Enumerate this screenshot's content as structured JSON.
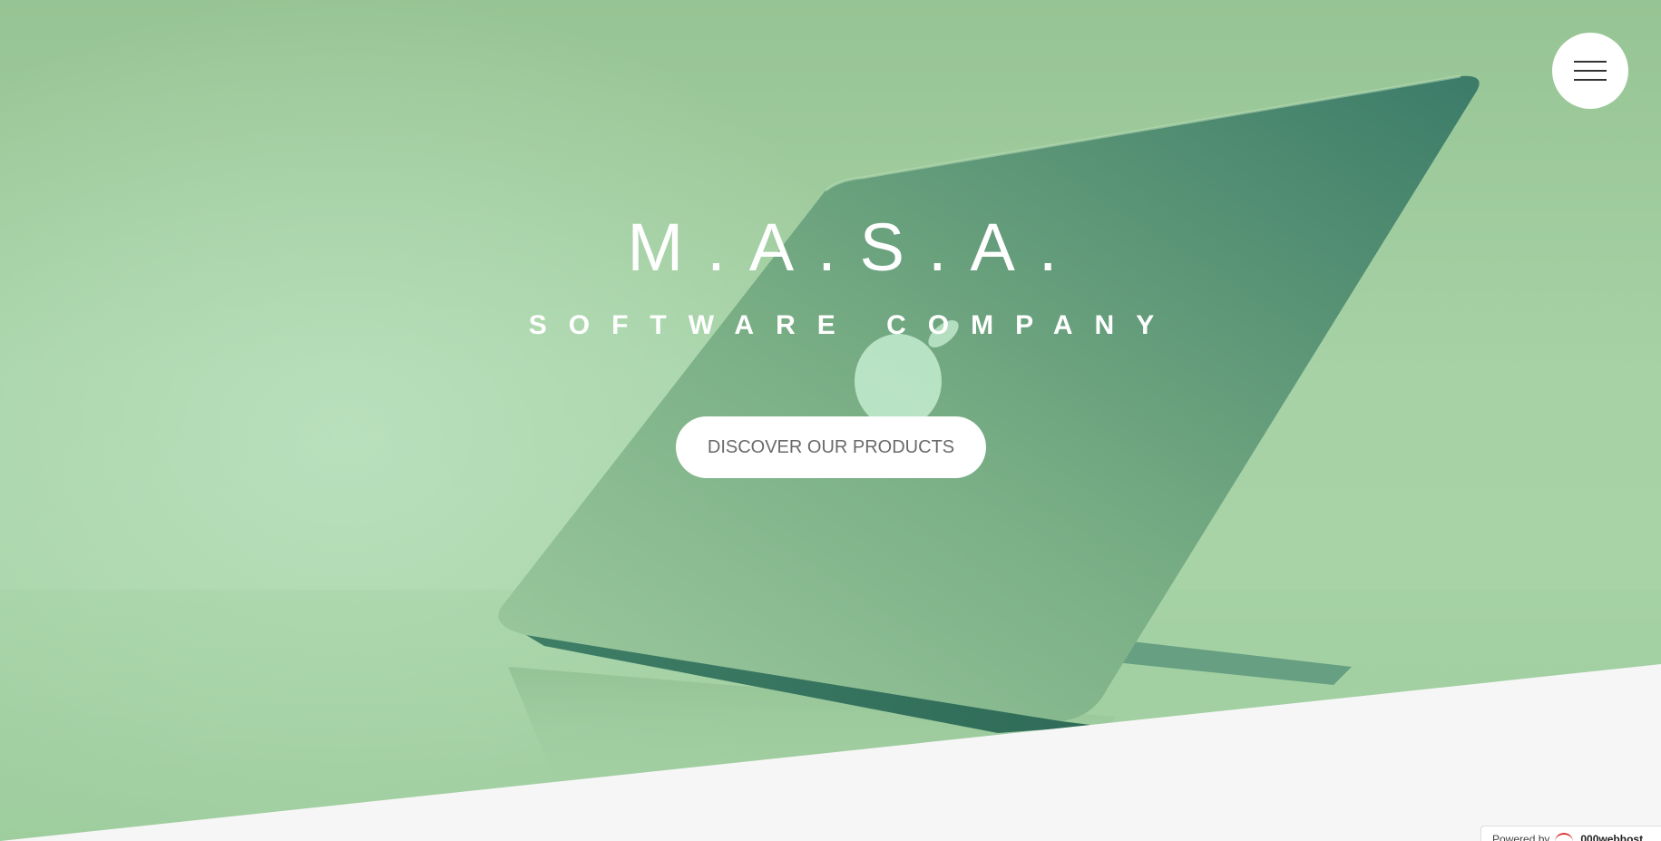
{
  "hero": {
    "title": "M.A.S.A.",
    "subtitle": "SOFTWARE COMPANY",
    "cta_label": "DISCOVER OUR PRODUCTS"
  },
  "menu": {
    "icon": "hamburger-menu-icon"
  },
  "footer_badge": {
    "powered_label": "Powered by",
    "brand": "000webhost"
  },
  "colors": {
    "hero_tint": "#a6d2a6",
    "laptop_dark": "#3f7f6a",
    "page_background": "#f6f6f6",
    "button_background": "#ffffff",
    "button_text": "#6a6a6a"
  }
}
